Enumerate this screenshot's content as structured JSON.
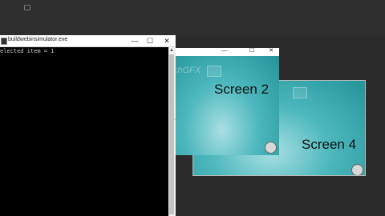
{
  "console": {
    "title": "buildwebinsimulator.exe",
    "minimize": "—",
    "maximize": "☐",
    "close": "✕",
    "output": "elected item = 1"
  },
  "simulator": {
    "minimize": "—",
    "maximize": "☐",
    "close": "✕"
  },
  "screens": {
    "screen2": {
      "label": "Screen 2",
      "logo": "chGFX"
    },
    "screen4": {
      "label": "Screen 4"
    }
  },
  "colors": {
    "desktop": "#2b2b2b",
    "teal": "#229499",
    "teal_light": "#a9dfe2"
  }
}
